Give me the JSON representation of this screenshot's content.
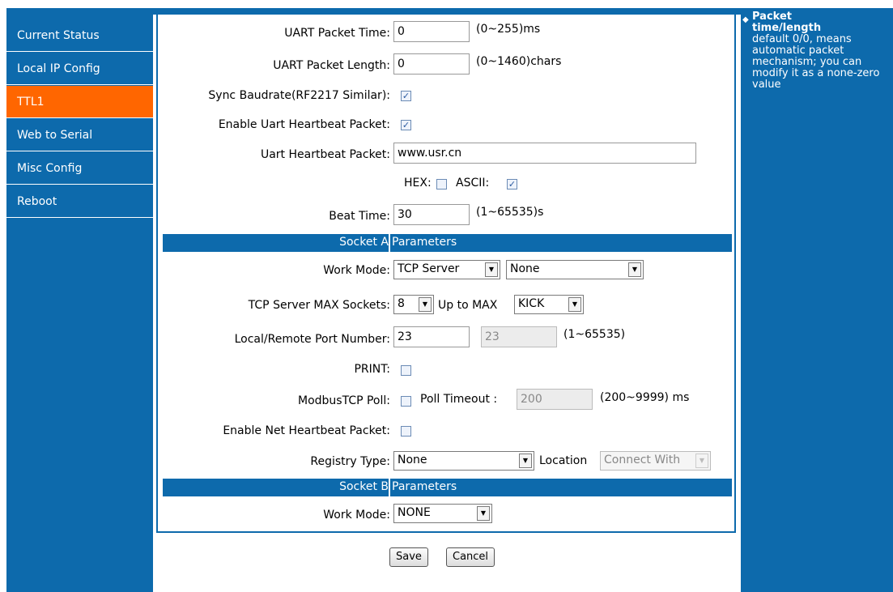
{
  "nav": {
    "items": [
      {
        "label": "Current Status"
      },
      {
        "label": "Local IP Config"
      },
      {
        "label": "TTL1"
      },
      {
        "label": "Web to Serial"
      },
      {
        "label": "Misc Config"
      },
      {
        "label": "Reboot"
      }
    ],
    "active": "TTL1",
    "accent": "#ff6600",
    "brand": "#0d6aac"
  },
  "help": {
    "partial_title": "Packet",
    "title": "time/length",
    "body": "default 0/0, means automatic packet mechanism; you can modify it as a none-zero value"
  },
  "uart": {
    "packet_time_label": "UART Packet Time:",
    "packet_time_value": "0",
    "packet_time_hint": "(0~255)ms",
    "packet_length_label": "UART Packet Length:",
    "packet_length_value": "0",
    "packet_length_hint": "(0~1460)chars",
    "sync_baud_label": "Sync Baudrate(RF2217 Similar):",
    "sync_baud_checked": true,
    "heartbeat_enable_label": "Enable Uart Heartbeat Packet:",
    "heartbeat_enable_checked": true,
    "heartbeat_packet_label": "Uart Heartbeat Packet:",
    "heartbeat_packet_value": "www.usr.cn",
    "hex_label": "HEX:",
    "hex_checked": false,
    "ascii_label": "ASCII:",
    "ascii_checked": true,
    "beat_time_label": "Beat Time:",
    "beat_time_value": "30",
    "beat_time_hint": "(1~65535)s"
  },
  "socket_a": {
    "header_left": "Socket A",
    "header_right": "Parameters",
    "work_mode_label": "Work Mode:",
    "work_mode_value": "TCP Server",
    "work_mode_sub_value": "None",
    "max_sockets_label": "TCP Server MAX Sockets:",
    "max_sockets_value": "8",
    "up_to_max_label": "Up to MAX",
    "up_to_max_value": "KICK",
    "port_label": "Local/Remote Port Number:",
    "local_port": "23",
    "remote_port": "23",
    "port_hint": "(1~65535)",
    "print_label": "PRINT:",
    "print_checked": false,
    "modbus_label": "ModbusTCP Poll:",
    "modbus_checked": false,
    "poll_timeout_label": "Poll Timeout :",
    "poll_timeout_value": "200",
    "poll_timeout_hint": "(200~9999) ms",
    "net_heartbeat_label": "Enable Net Heartbeat Packet:",
    "net_heartbeat_checked": false,
    "registry_label": "Registry Type:",
    "registry_value": "None",
    "location_label": "Location",
    "location_value": "Connect With"
  },
  "socket_b": {
    "header_left": "Socket B",
    "header_right": "Parameters",
    "work_mode_label": "Work Mode:",
    "work_mode_value": "NONE"
  },
  "actions": {
    "save": "Save",
    "cancel": "Cancel"
  }
}
